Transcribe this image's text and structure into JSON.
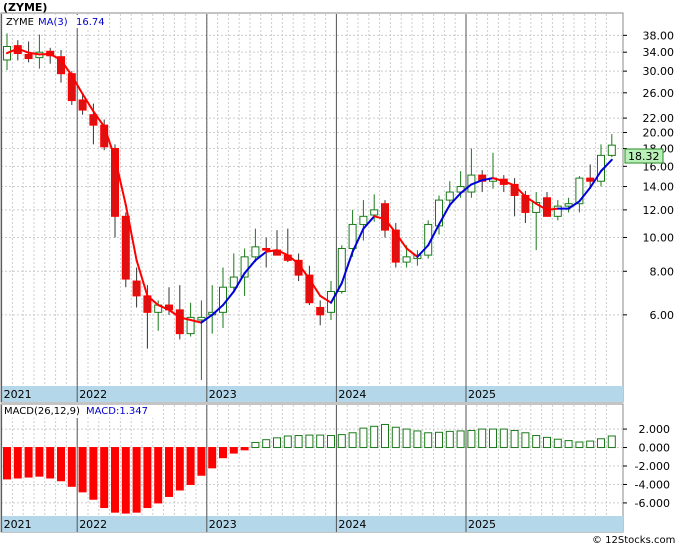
{
  "header": {
    "title": "(ZYME)"
  },
  "footer": {
    "credit": "© 12Stocks.com"
  },
  "colors": {
    "up": "#1a7a1a",
    "down": "#ff0000",
    "down_fill": "#dd1111",
    "ma_up": "#0000dd",
    "ma_down": "#ff0000",
    "macd_up": "#1a7a1a",
    "macd_down": "#ff0000",
    "axis_band": "#b4d7ea",
    "last_bg": "#b8f0b8",
    "grid": "#cccccc"
  },
  "chart_data": [
    {
      "type": "candlestick",
      "symbol": "ZYME",
      "period": "monthly",
      "legend": {
        "symbol": "ZYME",
        "ma_label": "MA(3)",
        "ma_value": "16.74"
      },
      "last_price_label": "18.32",
      "ylog": true,
      "ylim": [
        3.8,
        41.5
      ],
      "price_ticks": [
        6.0,
        8.0,
        10.0,
        12.0,
        14.0,
        16.0,
        18.0,
        20.0,
        22.0,
        26.0,
        30.0,
        34.0,
        38.0
      ],
      "price_tick_labels": [
        "6.00",
        "8.00",
        "10.00",
        "12.00",
        "14.00",
        "16.00",
        "18.00",
        "20.00",
        "22.00",
        "26.00",
        "30.00",
        "34.00",
        "38.00"
      ],
      "year_labels": [
        "2021",
        "2022",
        "2023",
        "2024",
        "2025"
      ],
      "year_start_index": [
        0,
        7,
        19,
        31,
        43
      ],
      "candles": [
        [
          32.3,
          38.5,
          30.2,
          35.3
        ],
        [
          35.5,
          36.8,
          32.2,
          33.7
        ],
        [
          33.5,
          36.5,
          31.8,
          32.6
        ],
        [
          32.8,
          38.2,
          30.5,
          34.0
        ],
        [
          34.2,
          35.0,
          31.5,
          33.2
        ],
        [
          33.0,
          34.5,
          27.8,
          29.5
        ],
        [
          29.5,
          30.0,
          24.0,
          24.7
        ],
        [
          24.8,
          26.0,
          22.5,
          23.2
        ],
        [
          22.5,
          24.2,
          18.5,
          21.0
        ],
        [
          21.0,
          21.8,
          17.8,
          18.2
        ],
        [
          18.0,
          18.5,
          10.0,
          11.5
        ],
        [
          11.5,
          11.8,
          7.2,
          7.6
        ],
        [
          7.5,
          8.2,
          6.3,
          6.8
        ],
        [
          6.8,
          7.3,
          4.8,
          6.1
        ],
        [
          6.1,
          6.6,
          5.4,
          6.4
        ],
        [
          6.4,
          7.2,
          6.0,
          6.2
        ],
        [
          6.2,
          7.3,
          5.1,
          5.3
        ],
        [
          5.3,
          6.5,
          5.2,
          5.9
        ],
        [
          5.8,
          6.6,
          3.9,
          5.9
        ],
        [
          6.0,
          7.3,
          5.3,
          6.1
        ],
        [
          6.1,
          8.2,
          5.5,
          7.2
        ],
        [
          7.2,
          9.0,
          7.0,
          7.7
        ],
        [
          7.7,
          9.3,
          6.8,
          8.8
        ],
        [
          8.8,
          10.6,
          8.5,
          9.4
        ],
        [
          9.3,
          10.0,
          8.2,
          9.2
        ],
        [
          9.2,
          10.5,
          8.9,
          8.9
        ],
        [
          8.9,
          10.6,
          8.5,
          8.6
        ],
        [
          8.6,
          9.0,
          7.5,
          7.8
        ],
        [
          7.8,
          8.3,
          6.4,
          6.5
        ],
        [
          6.3,
          6.6,
          5.6,
          6.0
        ],
        [
          6.1,
          7.5,
          5.8,
          7.0
        ],
        [
          7.0,
          9.5,
          6.9,
          9.3
        ],
        [
          9.3,
          12.0,
          8.8,
          10.9
        ],
        [
          10.9,
          12.8,
          9.8,
          11.5
        ],
        [
          11.6,
          13.3,
          11.1,
          12.0
        ],
        [
          12.5,
          12.8,
          10.0,
          10.5
        ],
        [
          10.5,
          11.0,
          8.2,
          8.5
        ],
        [
          8.5,
          9.5,
          8.2,
          8.8
        ],
        [
          8.7,
          9.2,
          8.3,
          8.9
        ],
        [
          8.9,
          11.2,
          8.7,
          10.9
        ],
        [
          10.8,
          13.2,
          10.2,
          12.8
        ],
        [
          12.8,
          14.5,
          12.2,
          13.5
        ],
        [
          13.5,
          15.5,
          13.0,
          14.0
        ],
        [
          13.5,
          18.0,
          13.0,
          15.1
        ],
        [
          15.1,
          15.6,
          13.5,
          14.5
        ],
        [
          14.5,
          17.5,
          13.8,
          14.8
        ],
        [
          14.7,
          15.1,
          13.5,
          14.2
        ],
        [
          14.2,
          14.8,
          11.5,
          13.2
        ],
        [
          13.2,
          13.6,
          11.0,
          11.8
        ],
        [
          11.8,
          13.5,
          9.2,
          12.6
        ],
        [
          13.0,
          13.5,
          11.5,
          11.5
        ],
        [
          11.5,
          12.8,
          11.2,
          12.3
        ],
        [
          12.3,
          13.0,
          11.8,
          12.5
        ],
        [
          12.5,
          15.0,
          11.8,
          14.8
        ],
        [
          14.8,
          16.2,
          13.8,
          14.5
        ],
        [
          14.5,
          18.5,
          14.0,
          17.2
        ],
        [
          17.2,
          19.8,
          17.0,
          18.4
        ]
      ],
      "ma3": [
        33.8,
        34.8,
        33.9,
        33.5,
        33.6,
        32.3,
        29.1,
        25.8,
        23.0,
        20.8,
        16.9,
        12.4,
        8.6,
        6.8,
        6.4,
        6.2,
        5.9,
        5.8,
        5.7,
        6.0,
        6.4,
        7.0,
        7.9,
        8.6,
        9.1,
        9.2,
        8.9,
        8.4,
        7.6,
        6.8,
        6.5,
        7.4,
        9.1,
        10.6,
        11.5,
        11.3,
        10.3,
        9.3,
        8.8,
        9.5,
        10.9,
        12.4,
        13.4,
        14.2,
        14.6,
        14.8,
        14.5,
        14.1,
        13.1,
        12.5,
        12.0,
        12.1,
        12.1,
        12.7,
        13.9,
        15.5,
        16.7
      ],
      "ma_dir": [
        "d",
        "d",
        "d",
        "d",
        "d",
        "d",
        "d",
        "d",
        "d",
        "d",
        "d",
        "d",
        "d",
        "d",
        "d",
        "d",
        "d",
        "d",
        "d",
        "u",
        "u",
        "u",
        "u",
        "u",
        "u",
        "d",
        "d",
        "d",
        "d",
        "d",
        "d",
        "u",
        "u",
        "u",
        "u",
        "d",
        "d",
        "d",
        "d",
        "u",
        "u",
        "u",
        "u",
        "u",
        "u",
        "u",
        "d",
        "d",
        "d",
        "d",
        "d",
        "d",
        "u",
        "u",
        "u",
        "u",
        "u"
      ]
    },
    {
      "type": "bar",
      "name": "MACD",
      "legend": {
        "label": "MACD(26,12,9)",
        "value_label": "MACD:1.347"
      },
      "ylim": [
        -7.2,
        3.2
      ],
      "ticks": [
        2.0,
        0.0,
        -2.0,
        -4.0,
        -6.0
      ],
      "tick_labels": [
        "2.000",
        "0.000",
        "-2.000",
        "-4.000",
        "-6.000"
      ],
      "values": [
        -3.4,
        -3.3,
        -3.2,
        -3.1,
        -3.3,
        -3.6,
        -4.2,
        -4.8,
        -5.6,
        -6.5,
        -7.0,
        -7.1,
        -7.0,
        -6.5,
        -6.0,
        -5.3,
        -4.6,
        -4.0,
        -3.0,
        -2.2,
        -1.1,
        -0.6,
        -0.25,
        0.55,
        0.85,
        1.05,
        1.25,
        1.3,
        1.35,
        1.35,
        1.3,
        1.4,
        1.6,
        2.1,
        2.3,
        2.5,
        2.2,
        2.0,
        1.8,
        1.6,
        1.65,
        1.75,
        1.8,
        1.85,
        2.0,
        2.0,
        2.0,
        1.85,
        1.6,
        1.3,
        1.1,
        0.9,
        0.75,
        0.6,
        0.7,
        0.95,
        1.25
      ],
      "year_labels": [
        "2021",
        "2022",
        "2023",
        "2024",
        "2025"
      ]
    }
  ]
}
